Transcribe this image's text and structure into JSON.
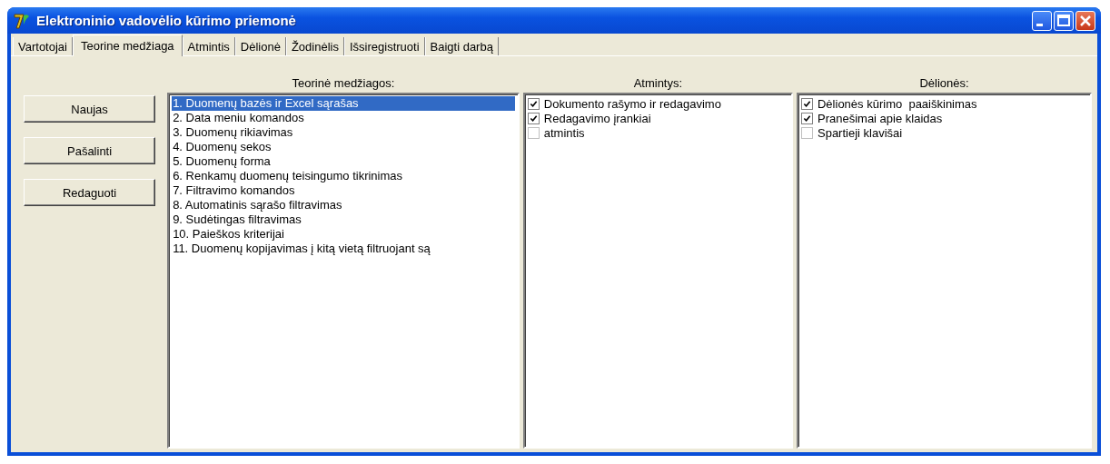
{
  "window": {
    "title": "Elektroninio vadovėlio kūrimo priemonė"
  },
  "tabs": [
    {
      "label": "Vartotojai",
      "selected": false
    },
    {
      "label": "Teorine medžiaga",
      "selected": true
    },
    {
      "label": "Atmintis",
      "selected": false
    },
    {
      "label": "Dėlionė",
      "selected": false
    },
    {
      "label": "Žodinėlis",
      "selected": false
    },
    {
      "label": "Išsiregistruoti",
      "selected": false
    },
    {
      "label": "Baigti darbą",
      "selected": false
    }
  ],
  "buttons": [
    "Naujas",
    "Pašalinti",
    "Redaguoti"
  ],
  "theory": {
    "heading": "Teorinė medžiagos:",
    "items": [
      {
        "label": "1. Duomenų bazės ir Excel sąrašas",
        "selected": true
      },
      {
        "label": "2. Data meniu komandos",
        "selected": false
      },
      {
        "label": "3. Duomenų rikiavimas",
        "selected": false
      },
      {
        "label": "4. Duomenų sekos",
        "selected": false
      },
      {
        "label": "5. Duomenų forma",
        "selected": false
      },
      {
        "label": "6. Renkamų duomenų teisingumo tikrinimas",
        "selected": false
      },
      {
        "label": "7. Filtravimo komandos",
        "selected": false
      },
      {
        "label": "8. Automatinis sąrašo filtravimas",
        "selected": false
      },
      {
        "label": "9. Sudėtingas filtravimas",
        "selected": false
      },
      {
        "label": "10. Paieškos kriterijai",
        "selected": false
      },
      {
        "label": "11. Duomenų kopijavimas į kitą vietą filtruojant są",
        "selected": false
      }
    ]
  },
  "memories": {
    "heading": "Atmintys:",
    "items": [
      {
        "label": "Dokumento rašymo ir redagavimo",
        "checked": true
      },
      {
        "label": "Redagavimo įrankiai",
        "checked": true
      },
      {
        "label": "atmintis",
        "checked": false
      }
    ]
  },
  "puzzles": {
    "heading": "Dėlionės:",
    "items": [
      {
        "label": "Dėlionės kūrimo  paaiškinimas",
        "checked": true
      },
      {
        "label": "Pranešimai apie klaidas",
        "checked": true
      },
      {
        "label": "Spartieji klavišai",
        "checked": false
      }
    ]
  }
}
